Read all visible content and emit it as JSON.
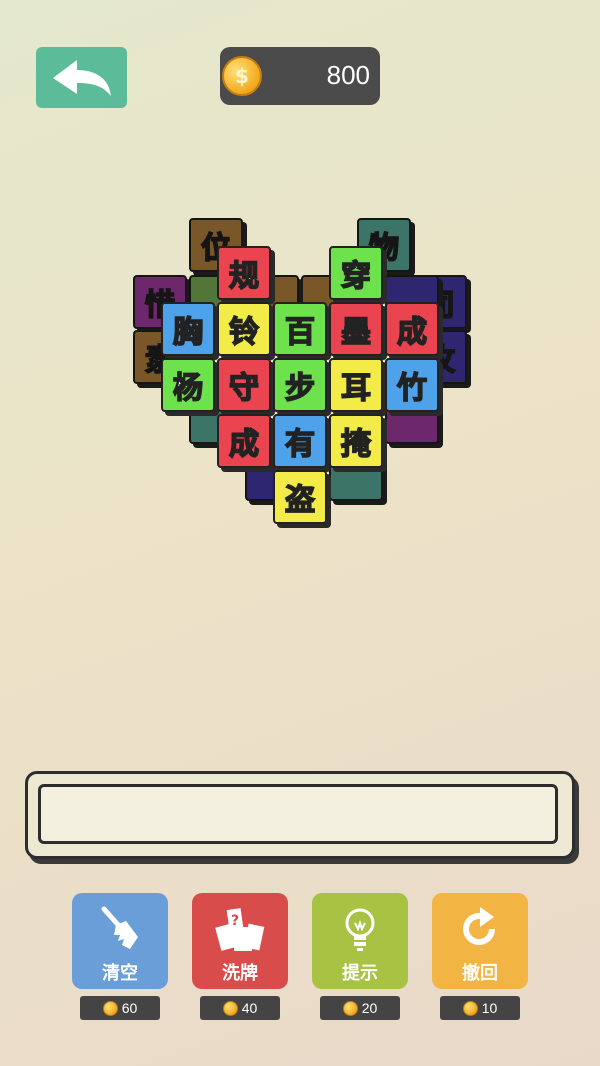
{
  "header": {
    "back_icon": "back-arrow-icon",
    "coins": "800",
    "coin_symbol": "$"
  },
  "board": {
    "bottom_layer": [
      "位",
      "物",
      "惜",
      "司",
      "素",
      "玫"
    ],
    "top_layer": [
      "规",
      "穿",
      "胸",
      "铃",
      "百",
      "墨",
      "成",
      "杨",
      "守",
      "步",
      "耳",
      "竹",
      "成",
      "有",
      "掩",
      "盗"
    ]
  },
  "tools": [
    {
      "label": "清空",
      "icon": "brush-icon",
      "cost": "60",
      "color": "#6a9ed8"
    },
    {
      "label": "洗牌",
      "icon": "shuffle-cards-icon",
      "cost": "40",
      "color": "#d94c4c"
    },
    {
      "label": "提示",
      "icon": "lightbulb-icon",
      "cost": "20",
      "color": "#a8c244"
    },
    {
      "label": "撤回",
      "icon": "undo-icon",
      "cost": "10",
      "color": "#f2b544"
    }
  ]
}
